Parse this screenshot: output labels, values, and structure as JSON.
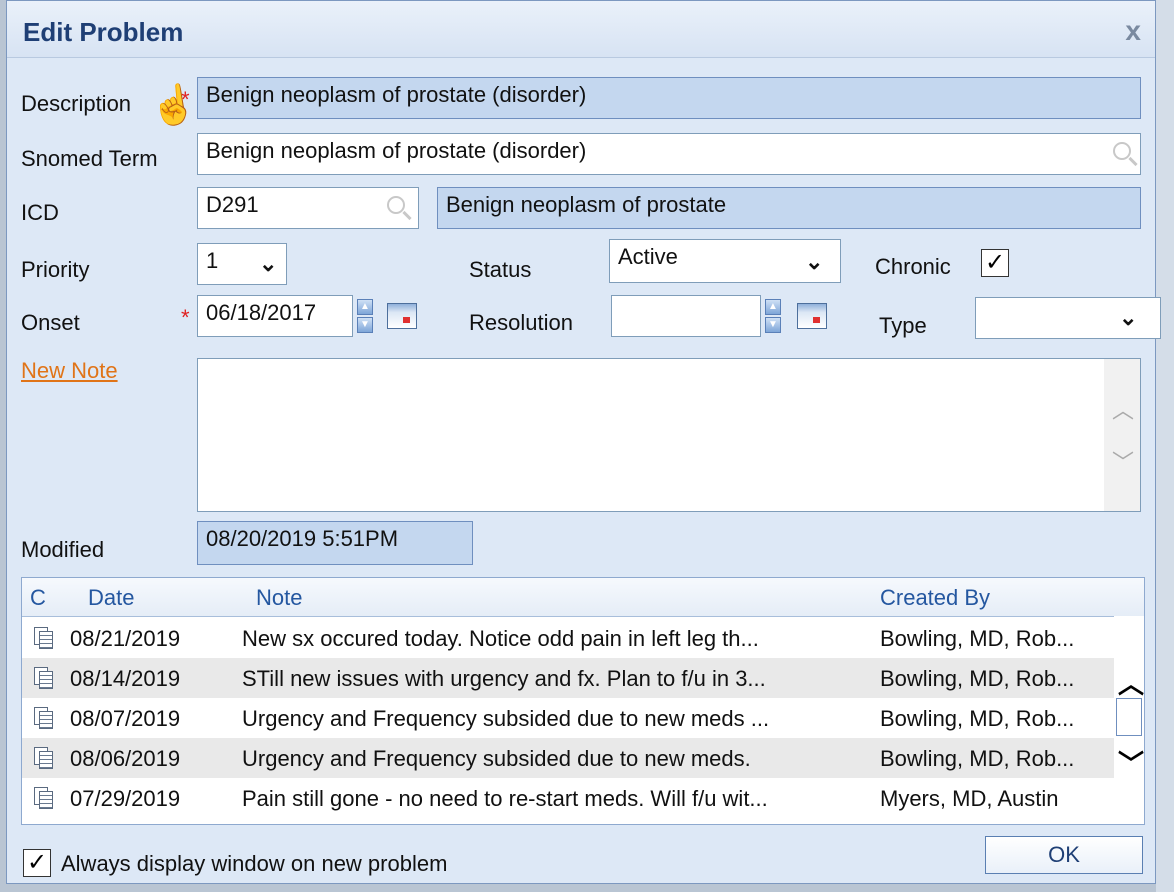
{
  "dialog": {
    "title": "Edit Problem",
    "close_label": "x"
  },
  "form": {
    "description_label": "Description",
    "description_value": "Benign neoplasm of prostate (disorder)",
    "snomed_label": "Snomed Term",
    "snomed_value": "Benign neoplasm of prostate (disorder)",
    "icd_label": "ICD",
    "icd_code": "D291",
    "icd_desc": "Benign neoplasm of prostate",
    "priority_label": "Priority",
    "priority_value": "1",
    "status_label": "Status",
    "status_value": "Active",
    "chronic_label": "Chronic",
    "chronic_checked": "✓",
    "onset_label": "Onset",
    "onset_value": "06/18/2017",
    "resolution_label": "Resolution",
    "resolution_value": "",
    "type_label": "Type",
    "type_value": "",
    "new_note_label": "New Note",
    "modified_label": "Modified",
    "modified_value": "08/20/2019  5:51PM"
  },
  "notes_grid": {
    "columns": [
      "C",
      "Date",
      "Note",
      "Created By"
    ],
    "rows": [
      {
        "date": "08/21/2019",
        "note": "New sx occured today. Notice odd pain in left leg th...",
        "created_by": "Bowling, MD, Rob..."
      },
      {
        "date": "08/14/2019",
        "note": "STill new issues with urgency and fx. Plan to f/u in 3...",
        "created_by": "Bowling, MD, Rob..."
      },
      {
        "date": "08/07/2019",
        "note": "Urgency and Frequency subsided due to new meds ...",
        "created_by": "Bowling, MD, Rob..."
      },
      {
        "date": "08/06/2019",
        "note": "Urgency and Frequency subsided due to new meds.",
        "created_by": "Bowling, MD, Rob..."
      },
      {
        "date": "07/29/2019",
        "note": "Pain still gone - no need to re-start meds. Will f/u wit...",
        "created_by": "Myers, MD, Austin"
      }
    ]
  },
  "footer": {
    "always_display_label": "Always display window on new problem",
    "always_display_checked": "✓",
    "ok_label": "OK"
  }
}
